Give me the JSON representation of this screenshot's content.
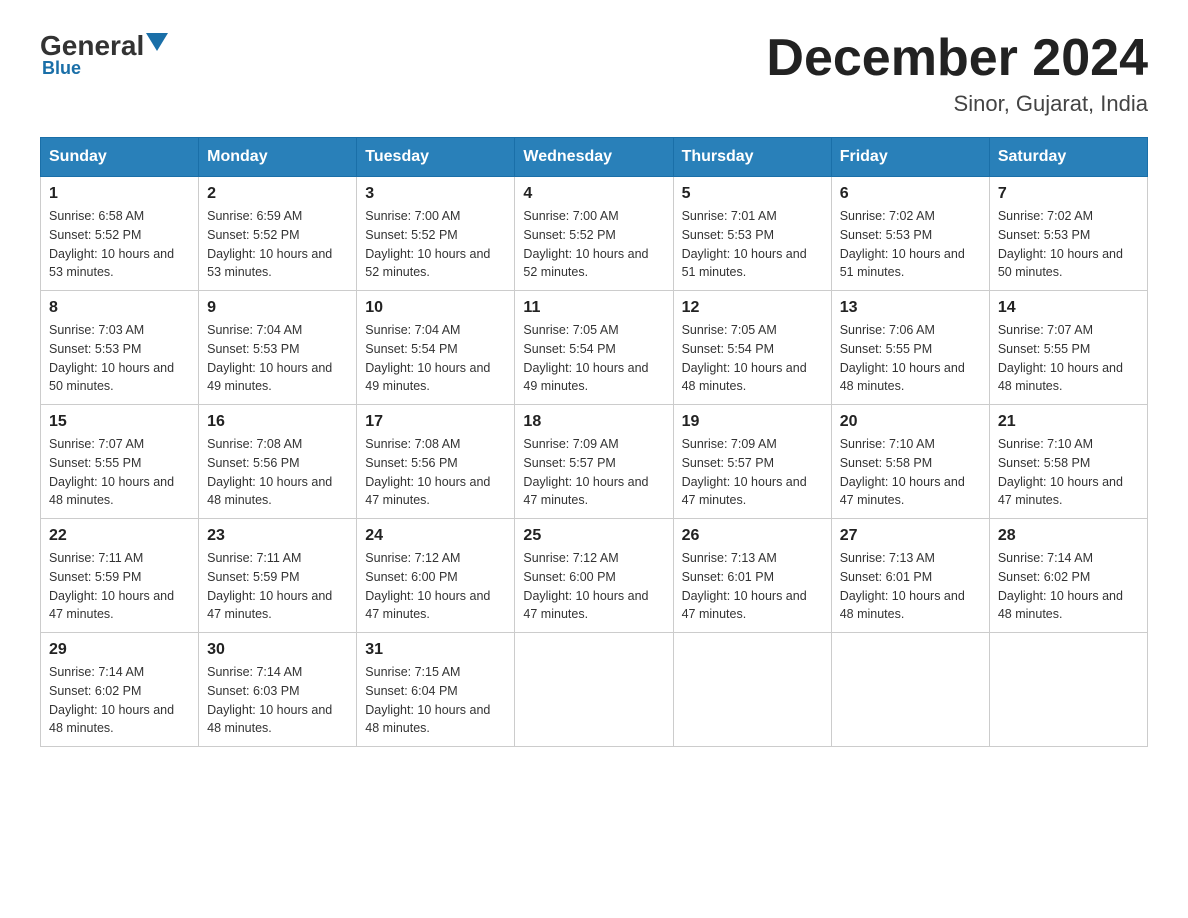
{
  "header": {
    "logo_general": "General",
    "logo_blue": "Blue",
    "month_title": "December 2024",
    "location": "Sinor, Gujarat, India"
  },
  "days_of_week": [
    "Sunday",
    "Monday",
    "Tuesday",
    "Wednesday",
    "Thursday",
    "Friday",
    "Saturday"
  ],
  "weeks": [
    [
      {
        "day": "1",
        "sunrise": "6:58 AM",
        "sunset": "5:52 PM",
        "daylight": "10 hours and 53 minutes."
      },
      {
        "day": "2",
        "sunrise": "6:59 AM",
        "sunset": "5:52 PM",
        "daylight": "10 hours and 53 minutes."
      },
      {
        "day": "3",
        "sunrise": "7:00 AM",
        "sunset": "5:52 PM",
        "daylight": "10 hours and 52 minutes."
      },
      {
        "day": "4",
        "sunrise": "7:00 AM",
        "sunset": "5:52 PM",
        "daylight": "10 hours and 52 minutes."
      },
      {
        "day": "5",
        "sunrise": "7:01 AM",
        "sunset": "5:53 PM",
        "daylight": "10 hours and 51 minutes."
      },
      {
        "day": "6",
        "sunrise": "7:02 AM",
        "sunset": "5:53 PM",
        "daylight": "10 hours and 51 minutes."
      },
      {
        "day": "7",
        "sunrise": "7:02 AM",
        "sunset": "5:53 PM",
        "daylight": "10 hours and 50 minutes."
      }
    ],
    [
      {
        "day": "8",
        "sunrise": "7:03 AM",
        "sunset": "5:53 PM",
        "daylight": "10 hours and 50 minutes."
      },
      {
        "day": "9",
        "sunrise": "7:04 AM",
        "sunset": "5:53 PM",
        "daylight": "10 hours and 49 minutes."
      },
      {
        "day": "10",
        "sunrise": "7:04 AM",
        "sunset": "5:54 PM",
        "daylight": "10 hours and 49 minutes."
      },
      {
        "day": "11",
        "sunrise": "7:05 AM",
        "sunset": "5:54 PM",
        "daylight": "10 hours and 49 minutes."
      },
      {
        "day": "12",
        "sunrise": "7:05 AM",
        "sunset": "5:54 PM",
        "daylight": "10 hours and 48 minutes."
      },
      {
        "day": "13",
        "sunrise": "7:06 AM",
        "sunset": "5:55 PM",
        "daylight": "10 hours and 48 minutes."
      },
      {
        "day": "14",
        "sunrise": "7:07 AM",
        "sunset": "5:55 PM",
        "daylight": "10 hours and 48 minutes."
      }
    ],
    [
      {
        "day": "15",
        "sunrise": "7:07 AM",
        "sunset": "5:55 PM",
        "daylight": "10 hours and 48 minutes."
      },
      {
        "day": "16",
        "sunrise": "7:08 AM",
        "sunset": "5:56 PM",
        "daylight": "10 hours and 48 minutes."
      },
      {
        "day": "17",
        "sunrise": "7:08 AM",
        "sunset": "5:56 PM",
        "daylight": "10 hours and 47 minutes."
      },
      {
        "day": "18",
        "sunrise": "7:09 AM",
        "sunset": "5:57 PM",
        "daylight": "10 hours and 47 minutes."
      },
      {
        "day": "19",
        "sunrise": "7:09 AM",
        "sunset": "5:57 PM",
        "daylight": "10 hours and 47 minutes."
      },
      {
        "day": "20",
        "sunrise": "7:10 AM",
        "sunset": "5:58 PM",
        "daylight": "10 hours and 47 minutes."
      },
      {
        "day": "21",
        "sunrise": "7:10 AM",
        "sunset": "5:58 PM",
        "daylight": "10 hours and 47 minutes."
      }
    ],
    [
      {
        "day": "22",
        "sunrise": "7:11 AM",
        "sunset": "5:59 PM",
        "daylight": "10 hours and 47 minutes."
      },
      {
        "day": "23",
        "sunrise": "7:11 AM",
        "sunset": "5:59 PM",
        "daylight": "10 hours and 47 minutes."
      },
      {
        "day": "24",
        "sunrise": "7:12 AM",
        "sunset": "6:00 PM",
        "daylight": "10 hours and 47 minutes."
      },
      {
        "day": "25",
        "sunrise": "7:12 AM",
        "sunset": "6:00 PM",
        "daylight": "10 hours and 47 minutes."
      },
      {
        "day": "26",
        "sunrise": "7:13 AM",
        "sunset": "6:01 PM",
        "daylight": "10 hours and 47 minutes."
      },
      {
        "day": "27",
        "sunrise": "7:13 AM",
        "sunset": "6:01 PM",
        "daylight": "10 hours and 48 minutes."
      },
      {
        "day": "28",
        "sunrise": "7:14 AM",
        "sunset": "6:02 PM",
        "daylight": "10 hours and 48 minutes."
      }
    ],
    [
      {
        "day": "29",
        "sunrise": "7:14 AM",
        "sunset": "6:02 PM",
        "daylight": "10 hours and 48 minutes."
      },
      {
        "day": "30",
        "sunrise": "7:14 AM",
        "sunset": "6:03 PM",
        "daylight": "10 hours and 48 minutes."
      },
      {
        "day": "31",
        "sunrise": "7:15 AM",
        "sunset": "6:04 PM",
        "daylight": "10 hours and 48 minutes."
      },
      null,
      null,
      null,
      null
    ]
  ]
}
